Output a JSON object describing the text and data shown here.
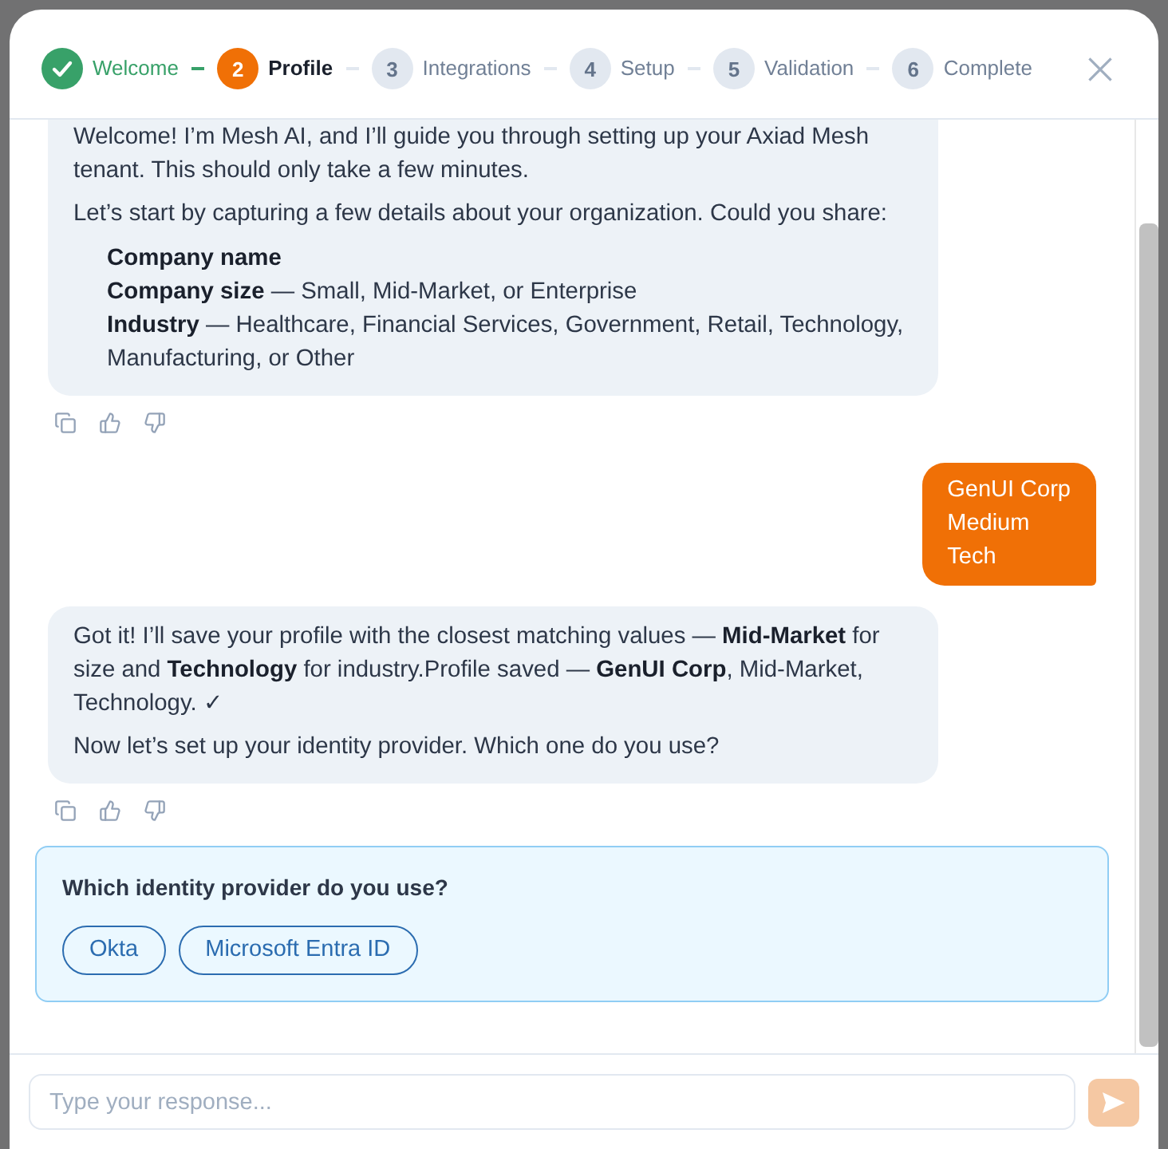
{
  "stepper": {
    "steps": [
      {
        "label": "Welcome",
        "completed": true,
        "current": false
      },
      {
        "number": "2",
        "label": "Profile",
        "completed": false,
        "current": true
      },
      {
        "number": "3",
        "label": "Integrations",
        "completed": false,
        "current": false
      },
      {
        "number": "4",
        "label": "Setup",
        "completed": false,
        "current": false
      },
      {
        "number": "5",
        "label": "Validation",
        "completed": false,
        "current": false
      },
      {
        "number": "6",
        "label": "Complete",
        "completed": false,
        "current": false
      }
    ]
  },
  "messages": [
    {
      "kind": "assistant",
      "blocks": [
        {
          "kind": "paragraph",
          "text": "Welcome! I’m Mesh AI, and I’ll guide you through setting up your Axiad Mesh tenant. This should only take a few minutes."
        },
        {
          "kind": "paragraph",
          "text": "Let’s start by capturing a few details about your organization. Could you share:"
        },
        {
          "kind": "list",
          "items": [
            "**Company name**",
            "**Company size** — Small, Mid-Market, or Enterprise",
            "**Industry** — Healthcare, Financial Services, Government, Retail, Technology, Manufacturing, or Other"
          ]
        }
      ]
    },
    {
      "kind": "user",
      "text": "GenUI Corp\nMedium\nTech"
    },
    {
      "kind": "assistant",
      "blocks": [
        {
          "kind": "paragraph",
          "text": "Got it! I’ll save your profile with the closest matching values — **Mid-Market** for size and **Technology** for industry.Profile saved — **GenUI Corp**, Mid-Market, Technology. ✓"
        },
        {
          "kind": "paragraph",
          "text": "Now let’s set up your identity provider. Which one do you use?"
        }
      ]
    }
  ],
  "question_card": {
    "title": "Which identity provider do you use?",
    "options": [
      {
        "label": "Okta",
        "selected": false
      },
      {
        "label": "Microsoft Entra ID",
        "selected": false
      }
    ]
  },
  "composer": {
    "placeholder": "Type your response...",
    "send_button": {
      "disabled": true
    }
  }
}
